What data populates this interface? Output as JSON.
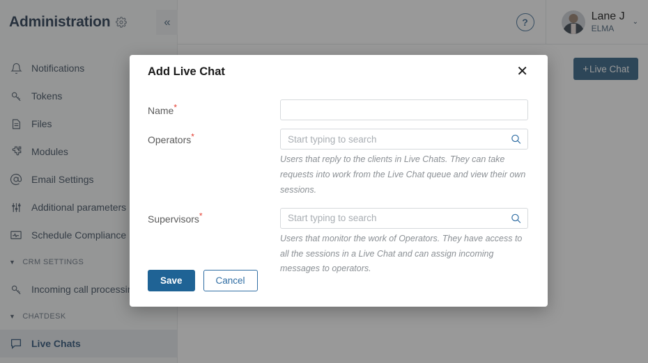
{
  "app": {
    "brand_title": "Administration",
    "brand_gear_icon": "gear-icon",
    "collapse_icon": "«"
  },
  "sidebar": {
    "items": [
      {
        "label": "Notifications",
        "icon": "bell-icon",
        "active": false
      },
      {
        "label": "Tokens",
        "icon": "key-icon",
        "active": false
      },
      {
        "label": "Files",
        "icon": "file-icon",
        "active": false
      },
      {
        "label": "Modules",
        "icon": "puzzle-icon",
        "active": false
      },
      {
        "label": "Email Settings",
        "icon": "at-icon",
        "active": false
      },
      {
        "label": "Additional parameters",
        "icon": "sliders-icon",
        "active": false
      },
      {
        "label": "Schedule Compliance",
        "icon": "schedule-icon",
        "active": false
      }
    ],
    "groups": [
      {
        "label": "CRM SETTINGS",
        "caret": "▼"
      },
      {
        "label": "CHATDESK",
        "caret": "▼"
      }
    ],
    "crm_items": [
      {
        "label": "Incoming call processing",
        "icon": "key-icon",
        "active": false
      }
    ],
    "chatdesk_items": [
      {
        "label": "Live Chats",
        "icon": "chat-bubble-icon",
        "active": true
      }
    ]
  },
  "topbar": {
    "help_label": "?",
    "user_name": "Lane J",
    "user_org": "ELMA",
    "user_chevron": "⌄"
  },
  "content": {
    "add_button_plus": "+",
    "add_button_label": "Live Chat"
  },
  "modal": {
    "title": "Add Live Chat",
    "close_label": "✕",
    "fields": {
      "name": {
        "label": "Name",
        "required_mark": "*",
        "value": "",
        "placeholder": ""
      },
      "operators": {
        "label": "Operators",
        "required_mark": "*",
        "value": "",
        "placeholder": "Start typing to search",
        "hint": "Users that reply to the clients in Live Chats. They can take requests into work from the Live Chat queue and view their own sessions."
      },
      "supervisors": {
        "label": "Supervisors",
        "required_mark": "*",
        "value": "",
        "placeholder": "Start typing to search",
        "hint": "Users that monitor the work of Operators. They have access to all the sessions in a Live Chat and can assign incoming messages to operators."
      }
    },
    "save_label": "Save",
    "cancel_label": "Cancel"
  },
  "colors": {
    "accent": "#1f6395",
    "brand_dark": "#1f5278",
    "required": "#e33b2e",
    "sidebar_bg": "#f7f8f9",
    "active_item": "#e4e8ec"
  }
}
